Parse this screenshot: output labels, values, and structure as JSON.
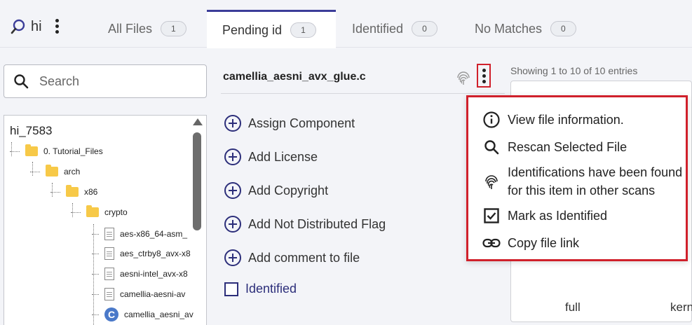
{
  "app": {
    "name": "hi"
  },
  "tabs": [
    {
      "label": "All Files",
      "count": "1"
    },
    {
      "label": "Pending id",
      "count": "1"
    },
    {
      "label": "Identified",
      "count": "0"
    },
    {
      "label": "No Matches",
      "count": "0"
    }
  ],
  "search": {
    "placeholder": "Search"
  },
  "tree": {
    "root": "hi_7583",
    "nodes": [
      {
        "label": "0. Tutorial_Files",
        "type": "folder"
      },
      {
        "label": "arch",
        "type": "folder"
      },
      {
        "label": "x86",
        "type": "folder"
      },
      {
        "label": "crypto",
        "type": "folder"
      },
      {
        "label": "aes-x86_64-asm_",
        "type": "file"
      },
      {
        "label": "aes_ctrby8_avx-x8",
        "type": "file"
      },
      {
        "label": "aesni-intel_avx-x8",
        "type": "file"
      },
      {
        "label": "camellia-aesni-av",
        "type": "file"
      },
      {
        "label": "camellia_aesni_av",
        "type": "c-file"
      }
    ]
  },
  "file_panel": {
    "filename": "camellia_aesni_avx_glue.c",
    "actions": [
      {
        "label": "Assign Component"
      },
      {
        "label": "Add License"
      },
      {
        "label": "Add Copyright"
      },
      {
        "label": "Add Not Distributed Flag"
      },
      {
        "label": "Add comment to file"
      }
    ],
    "identified_label": "Identified"
  },
  "results": {
    "showing": "Showing 1 to 10 of 10 entries",
    "col_full": "full",
    "col_kern": "kern"
  },
  "menu": {
    "items": [
      {
        "label": "View file information.",
        "icon": "info-icon"
      },
      {
        "label": "Rescan Selected File",
        "icon": "search-icon"
      },
      {
        "label": "Identifications have been found",
        "label2": "for this item in other scans",
        "icon": "fingerprint-icon"
      },
      {
        "label": "Mark as Identified",
        "icon": "checkbox-checked-icon"
      },
      {
        "label": "Copy file link",
        "icon": "link-icon"
      }
    ]
  },
  "colors": {
    "accent": "#3b3d99",
    "highlight": "#d0202b",
    "action": "#2c2e7a",
    "folder": "#f7c948"
  }
}
